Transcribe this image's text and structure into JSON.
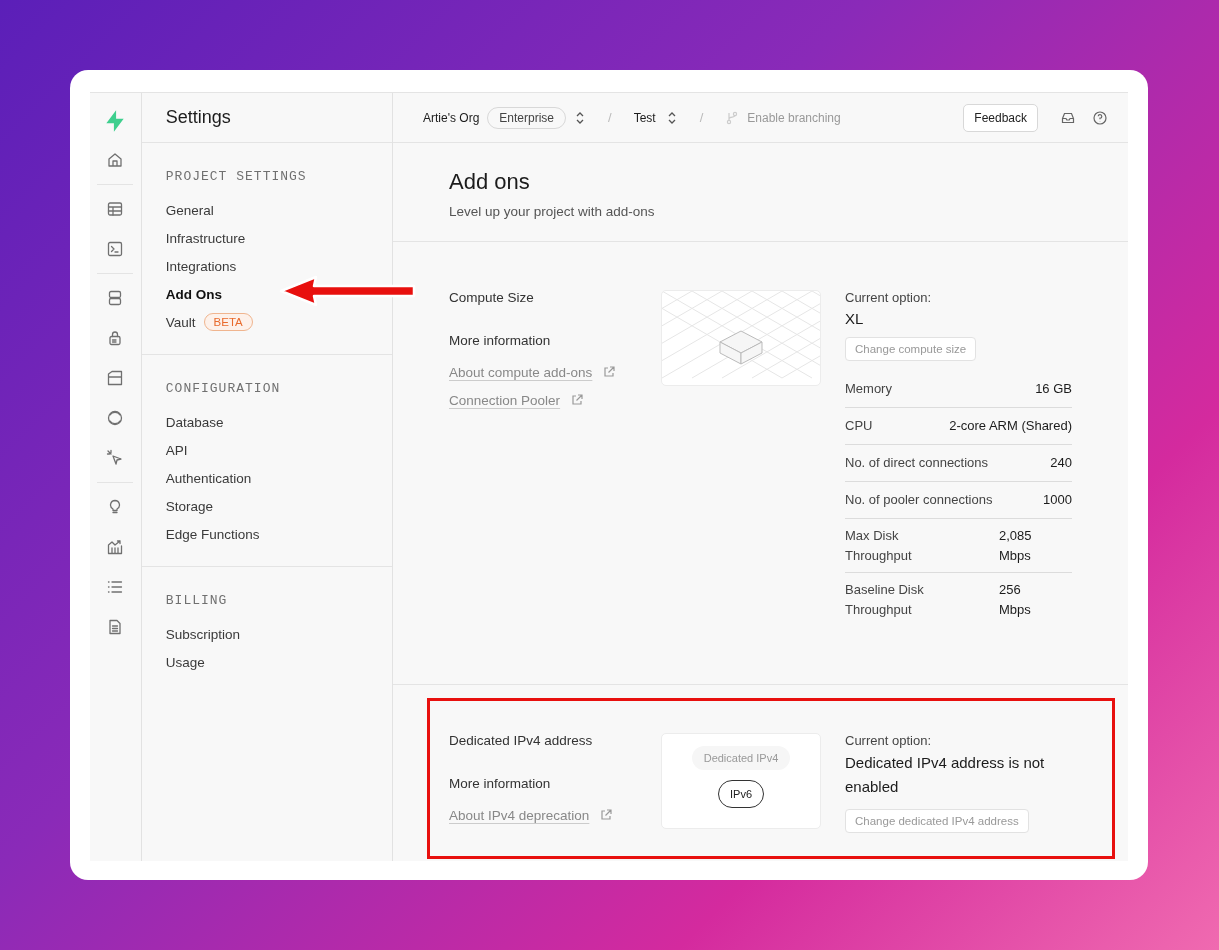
{
  "settings_sidebar": {
    "title": "Settings",
    "sections": [
      {
        "heading": "PROJECT SETTINGS",
        "items": [
          {
            "label": "General",
            "selected": false
          },
          {
            "label": "Infrastructure",
            "selected": false
          },
          {
            "label": "Integrations",
            "selected": false
          },
          {
            "label": "Add Ons",
            "selected": true
          },
          {
            "label": "Vault",
            "selected": false,
            "badge": "BETA"
          }
        ]
      },
      {
        "heading": "CONFIGURATION",
        "items": [
          {
            "label": "Database",
            "selected": false
          },
          {
            "label": "API",
            "selected": false
          },
          {
            "label": "Authentication",
            "selected": false
          },
          {
            "label": "Storage",
            "selected": false
          },
          {
            "label": "Edge Functions",
            "selected": false
          }
        ]
      },
      {
        "heading": "BILLING",
        "items": [
          {
            "label": "Subscription",
            "selected": false
          },
          {
            "label": "Usage",
            "selected": false
          }
        ]
      }
    ]
  },
  "top_bar": {
    "org": "Artie's Org",
    "plan": "Enterprise",
    "project": "Test",
    "separator": "/",
    "branching": "Enable branching",
    "feedback": "Feedback"
  },
  "page": {
    "title": "Add ons",
    "subtitle": "Level up your project with add-ons"
  },
  "addons": [
    {
      "kind": "compute",
      "name": "Compute Size",
      "more_info": "More information",
      "links": [
        "About compute add-ons",
        "Connection Pooler"
      ],
      "current_label": "Current option:",
      "current_value": "XL",
      "change_button": "Change compute size",
      "specs": [
        {
          "kind": "inline",
          "label": "Memory",
          "value": "16 GB"
        },
        {
          "kind": "inline",
          "label": "CPU",
          "value": "2-core ARM (Shared)"
        },
        {
          "kind": "inline",
          "label": "No. of direct connections",
          "value": "240"
        },
        {
          "kind": "inline",
          "label": "No. of pooler connections",
          "value": "1000"
        },
        {
          "kind": "wrapped",
          "label": "Max Disk Throughput",
          "value": "2,085 Mbps"
        },
        {
          "kind": "wrapped",
          "label": "Baseline Disk Throughput",
          "value": "256 Mbps"
        }
      ]
    },
    {
      "kind": "ipv4",
      "name": "Dedicated IPv4 address",
      "more_info": "More information",
      "links": [
        "About IPv4 deprecation"
      ],
      "pills": [
        {
          "label": "Dedicated IPv4",
          "selected": false
        },
        {
          "label": "IPv6",
          "selected": true
        }
      ],
      "current_label": "Current option:",
      "current_value": "Dedicated IPv4 address is not enabled",
      "change_button": "Change dedicated IPv4 address"
    }
  ]
}
